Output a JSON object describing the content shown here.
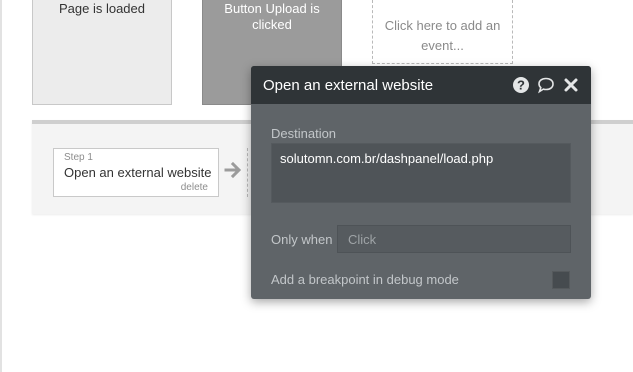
{
  "events": {
    "page_loaded": "Page is loaded",
    "button_upload_line1": "Button Upload is",
    "button_upload_line2": "clicked",
    "add_event_line1": "Click here to add an",
    "add_event_line2": "event..."
  },
  "workflow": {
    "step_number": "Step 1",
    "step_title": "Open an external website",
    "delete_label": "delete",
    "arrow_icon": "arrow-right-icon"
  },
  "popup": {
    "title": "Open an external website",
    "icons": [
      "help-icon",
      "comment-icon",
      "close-icon"
    ],
    "destination_label": "Destination",
    "destination_value": "solutomn.com.br/dashpanel/load.php",
    "only_when_label": "Only when",
    "only_when_placeholder": "Click",
    "breakpoint_label": "Add a breakpoint in debug mode",
    "breakpoint_checked": false
  },
  "colors": {
    "popup_header": "#2f3437",
    "popup_body": "#5f6468",
    "selected_event_card": "#9b9b9b"
  }
}
